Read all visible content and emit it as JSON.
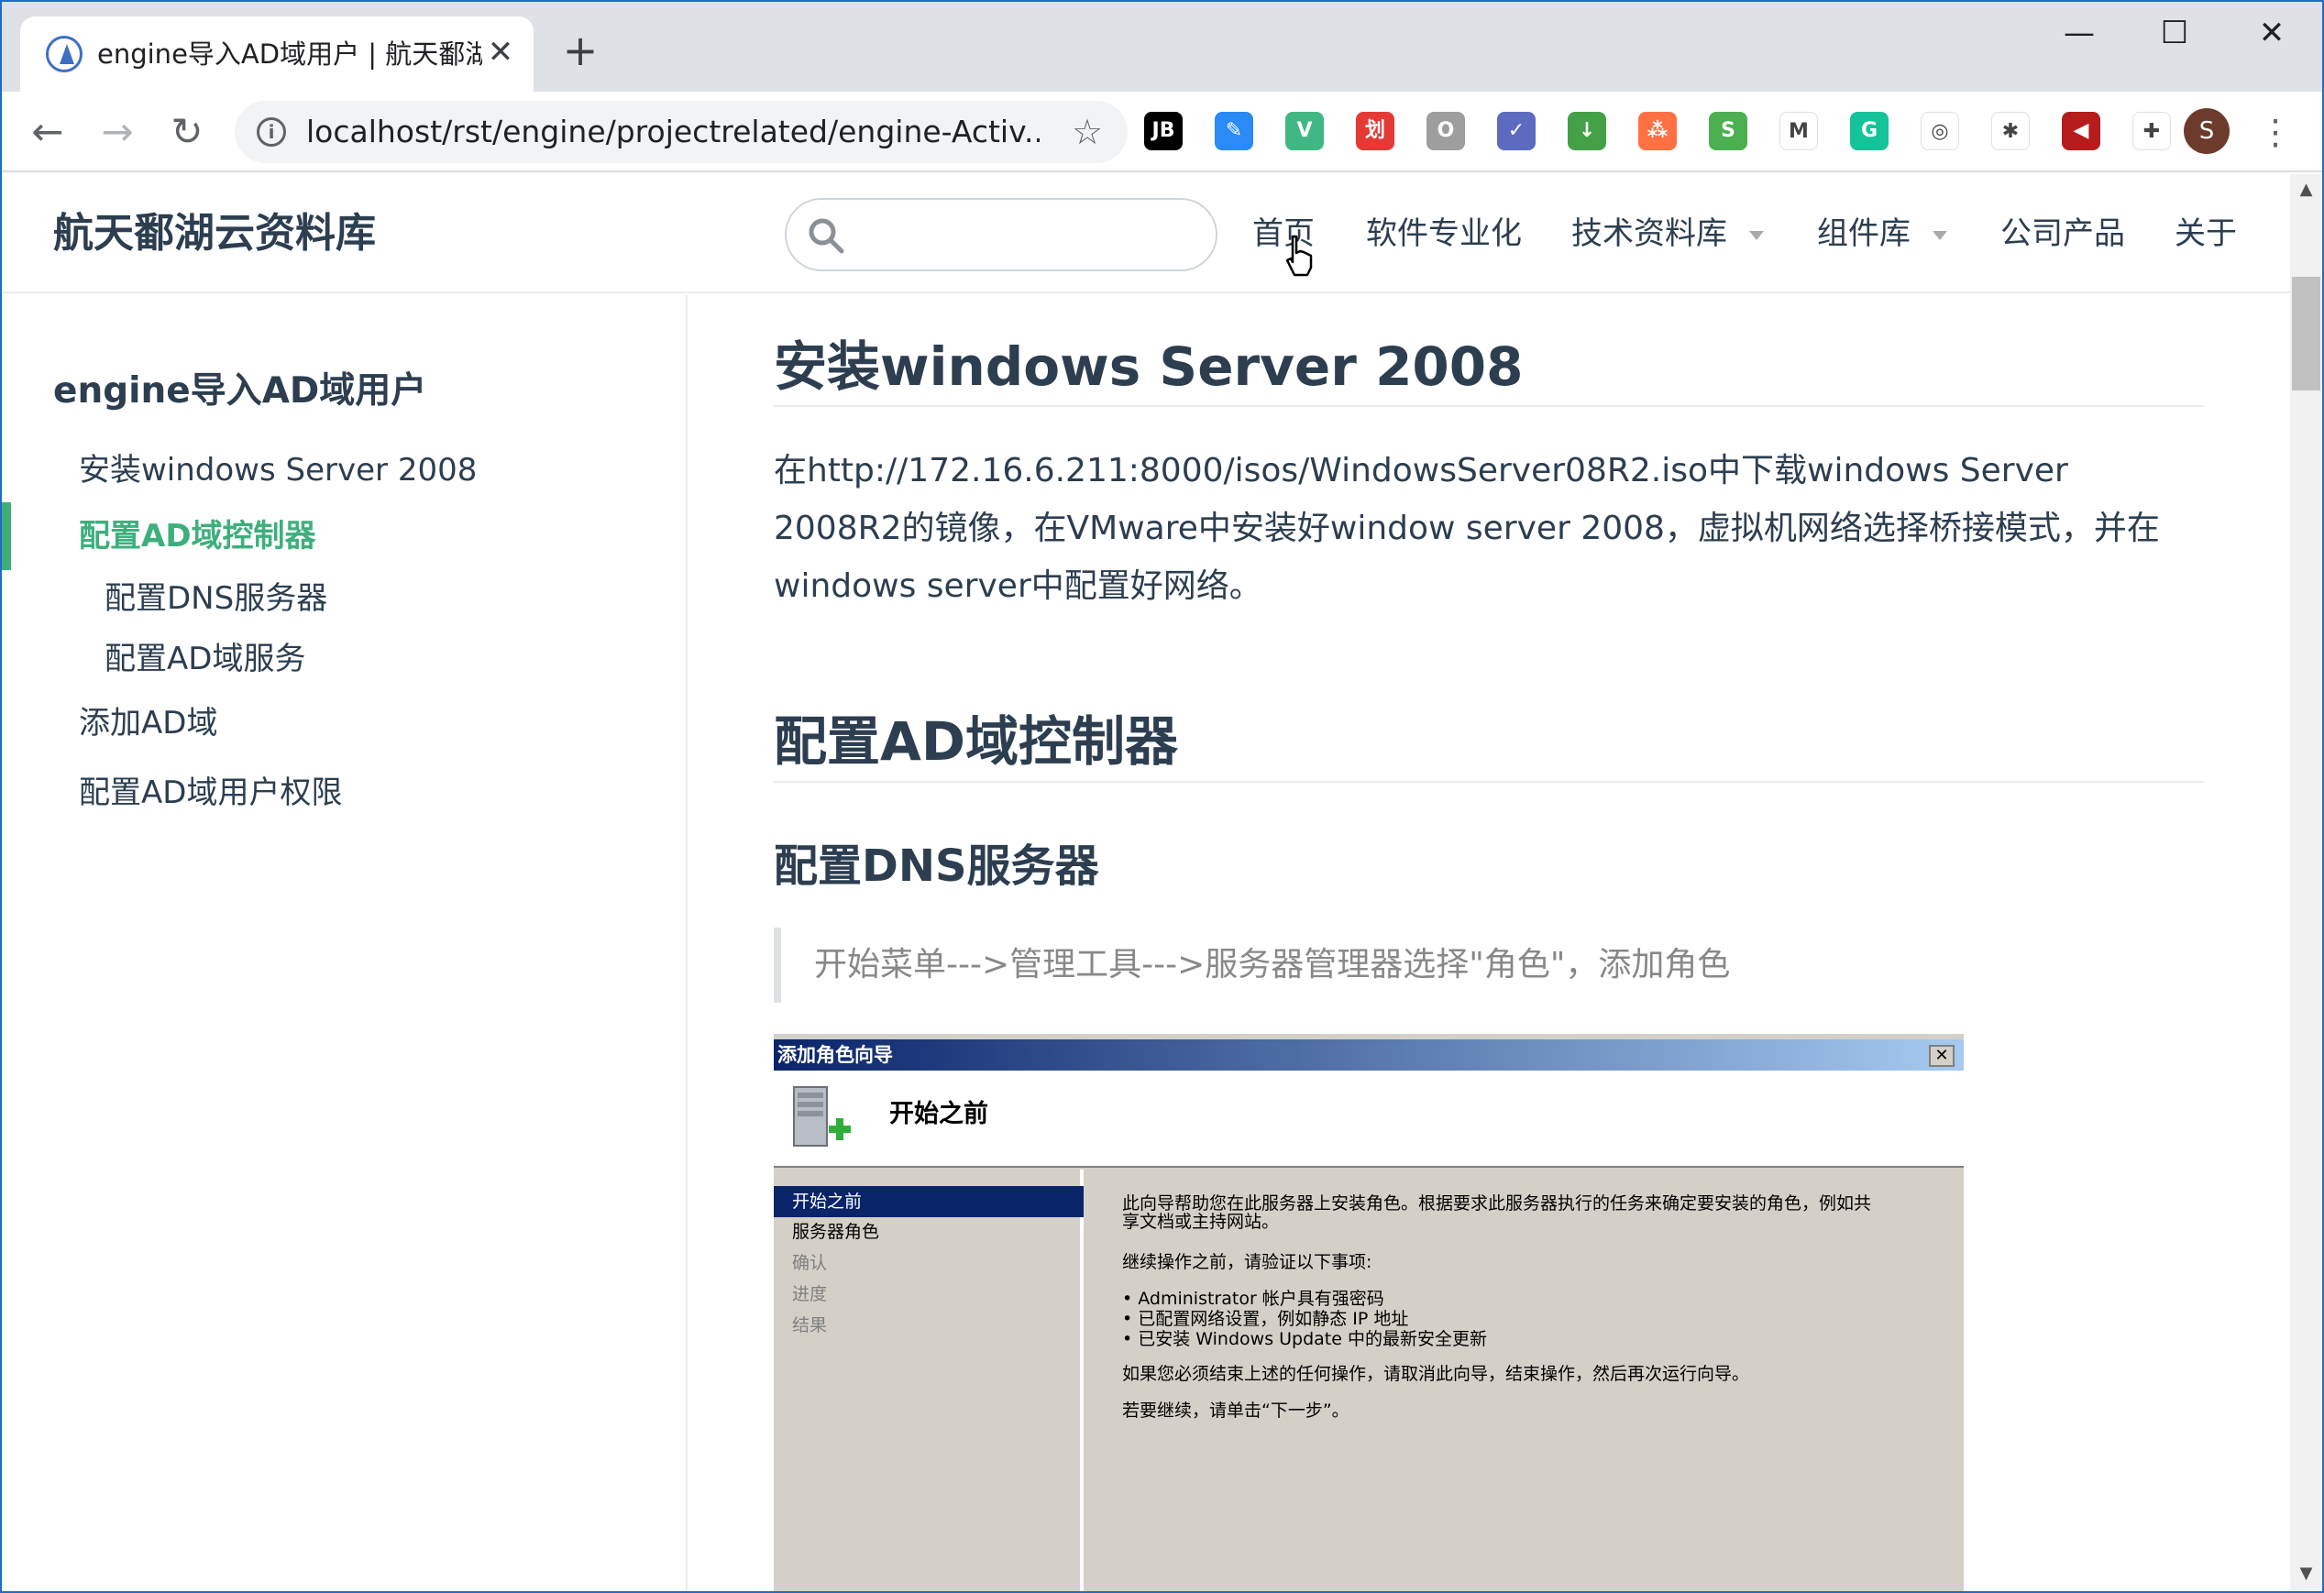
{
  "browser": {
    "tab": {
      "title": "engine导入AD域用户 | 航天鄱湖",
      "close": "✕"
    },
    "new_tab": "+",
    "window_controls": {
      "minimize": "—",
      "maximize": "☐",
      "close": "✕"
    },
    "nav": {
      "back": "←",
      "forward": "→",
      "reload": "↻"
    },
    "url": "localhost/rst/engine/projectrelated/engine-Activ...",
    "info_icon": "i",
    "bookmark_icon": "☆",
    "extensions": [
      {
        "name": "jetbrains-icon",
        "label": "JB",
        "color": "#000000"
      },
      {
        "name": "pen-extension-icon",
        "label": "✎",
        "color": "#2a8af6"
      },
      {
        "name": "vue-devtools-icon",
        "label": "V",
        "color": "#41b883"
      },
      {
        "name": "red-extension-icon",
        "label": "划",
        "color": "#e53935"
      },
      {
        "name": "office-icon",
        "label": "O",
        "color": "#9e9e9e"
      },
      {
        "name": "check-extension-icon",
        "label": "✓",
        "color": "#5c6bc0"
      },
      {
        "name": "download-extension-icon",
        "label": "↓",
        "color": "#43a047"
      },
      {
        "name": "network-extension-icon",
        "label": "⁂",
        "color": "#ff7043"
      },
      {
        "name": "s-extension-icon",
        "label": "S",
        "color": "#4caf50"
      },
      {
        "name": "m-extension-icon",
        "label": "M",
        "color": "#ffffff"
      },
      {
        "name": "grammarly-icon",
        "label": "G",
        "color": "#15c39a"
      },
      {
        "name": "glasses-extension-icon",
        "label": "◎",
        "color": "#ffffff"
      },
      {
        "name": "color-picker-icon",
        "label": "✱",
        "color": "#ffffff"
      },
      {
        "name": "audio-extension-icon",
        "label": "◀",
        "color": "#b71c1c"
      },
      {
        "name": "extensions-puzzle-icon",
        "label": "✚",
        "color": "#ffffff"
      }
    ],
    "profile": "S",
    "menu": "⋮"
  },
  "site": {
    "title": "航天鄱湖云资料库",
    "nav": [
      "首页",
      "软件专业化",
      "技术资料库",
      "组件库",
      "公司产品",
      "关于"
    ]
  },
  "sidebar": {
    "heading": "engine导入AD域用户",
    "items": [
      {
        "label": "安装windows Server 2008"
      },
      {
        "label": "配置AD域控制器"
      },
      {
        "label": "配置DNS服务器"
      },
      {
        "label": "配置AD域服务"
      },
      {
        "label": "添加AD域"
      },
      {
        "label": "配置AD域用户权限"
      }
    ]
  },
  "content": {
    "h1": "安装windows Server 2008",
    "paragraph": "在http://172.16.6.211:8000/isos/WindowsServer08R2.iso中下载windows Server 2008R2的镜像，在VMware中安装好window server 2008，虚拟机网络选择桥接模式，并在windows server中配置好网络。",
    "h2": "配置AD域控制器",
    "h3": "配置DNS服务器",
    "quote": "开始菜单--->管理工具--->服务器管理器选择\"角色\"，添加角色",
    "dialog": {
      "title": "添加角色向导",
      "close": "✕",
      "header": "开始之前",
      "steps": [
        "开始之前",
        "服务器角色",
        "确认",
        "进度",
        "结果"
      ],
      "lines": [
        "此向导帮助您在此服务器上安装角色。根据要求此服务器执行的任务来确定要安装的角色，例如共",
        "享文档或主持网站。",
        "继续操作之前，请验证以下事项:",
        "• Administrator 帐户具有强密码",
        "• 已配置网络设置，例如静态 IP 地址",
        "• 已安装 Windows Update 中的最新安全更新",
        "如果您必须结束上述的任何操作，请取消此向导，结束操作，然后再次运行向导。",
        "若要继续，请单击“下一步”。"
      ]
    }
  },
  "colors": {
    "accent": "#3eaf7c",
    "text": "#2c3e50",
    "frame": "#1f6cc7"
  }
}
